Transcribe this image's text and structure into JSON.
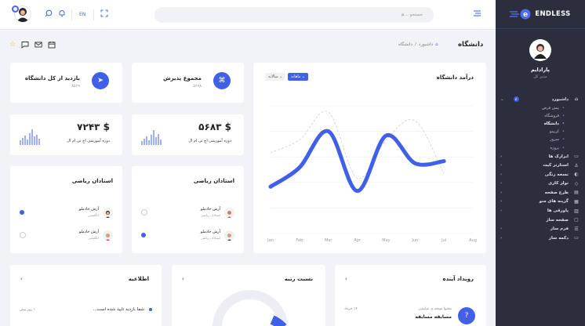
{
  "brand": {
    "name": "ENDLESS"
  },
  "profile": {
    "name": "پارادایم",
    "role": "مدیر کل"
  },
  "menu": {
    "dashboard": {
      "label": "داشبورد",
      "badge": "۶"
    },
    "sub": [
      "پیش فرض",
      "فروشگاه",
      "دانشگاه",
      "کریپتو",
      "سرور",
      "پروژه"
    ],
    "items": [
      "ابزارک ها",
      "استارتر کیت",
      "نسخه رنگی",
      "تولز کاری",
      "طرح صفحه",
      "گزینه های منو",
      "پاورقی ها",
      "صفحه ساز",
      "فرم ساز",
      "دکمه ساز"
    ]
  },
  "topbar": {
    "search_placeholder": "جستجو ...",
    "lang": "EN"
  },
  "header": {
    "title": "دانشگاه",
    "breadcrumb": [
      "داشبورد",
      "/",
      "دانشگاه"
    ]
  },
  "stats": [
    {
      "title": "مجموع پذیرش",
      "value": "۵۶۷۸"
    },
    {
      "title": "بازدید از کل دانشگاه",
      "value": "۸۵۶۹"
    }
  ],
  "values": [
    {
      "amount": "$ ۵۶۸۳",
      "label": "دوره آموزشی اچ تی ام ال"
    },
    {
      "amount": "$ ۷۲۴۳",
      "label": "دوره آموزشی اچ تی ام ال"
    }
  ],
  "teachers": [
    {
      "title": "استادان ریاضی",
      "rows": [
        {
          "name": "آرش خادملو",
          "role": "استادان ریاضی"
        },
        {
          "name": "آرش خادملو",
          "role": "استادان ریاضی"
        }
      ]
    },
    {
      "title": "استادان ریاضی",
      "rows": [
        {
          "name": "آرش خادملو",
          "role": "انگلیسی"
        },
        {
          "name": "آرش خادملو",
          "role": "انگلیسی"
        }
      ]
    }
  ],
  "chart": {
    "title": "درآمد دانشگاه",
    "btn_monthly": "ماهانه",
    "btn_yearly": "سالانه",
    "accent": "#4060e8"
  },
  "chart_data": {
    "type": "line",
    "categories": [
      "Jan",
      "Feb",
      "Mar",
      "Apr",
      "May",
      "Jun",
      "Jul",
      "Aug"
    ],
    "series": [
      {
        "values": [
          2.2,
          3.1,
          4.8,
          2.0,
          4.6,
          3.3,
          3.4
        ]
      },
      {
        "values": [
          3.8,
          4.4,
          5.7,
          2.6,
          4.4,
          5.3,
          2.8
        ]
      }
    ],
    "ylim": [
      0,
      6
    ]
  },
  "bottom": {
    "events": {
      "title": "رویداد آینده",
      "item": "مسابقه مسابقه",
      "desc": "محتوا نسخه ی نمایشی",
      "date": "۱۴ خرداد"
    },
    "ratio": {
      "title": "نسبت رتبه"
    },
    "notices": {
      "title": "اطلاعیه",
      "text": "شما بازدید تایید شده است...",
      "time": "۱ روز پیش"
    }
  }
}
